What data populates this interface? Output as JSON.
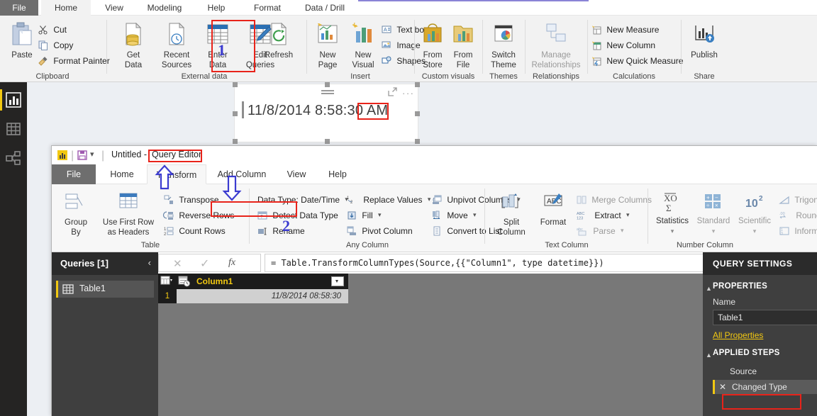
{
  "main_window": {
    "tabs": [
      {
        "label": "File",
        "state": "file"
      },
      {
        "label": "Home",
        "state": "active"
      },
      {
        "label": "View",
        "state": "normal"
      },
      {
        "label": "Modeling",
        "state": "normal"
      },
      {
        "label": "Help",
        "state": "normal"
      },
      {
        "label": "Format",
        "state": "contextual"
      },
      {
        "label": "Data / Drill",
        "state": "contextual"
      }
    ],
    "ribbon": {
      "groups": [
        {
          "label": "Clipboard"
        },
        {
          "label": "External data"
        },
        {
          "label": "Insert"
        },
        {
          "label": "Custom visuals"
        },
        {
          "label": "Themes"
        },
        {
          "label": "Relationships"
        },
        {
          "label": "Calculations"
        },
        {
          "label": "Share"
        }
      ],
      "clipboard": {
        "paste": "Paste",
        "cut": "Cut",
        "copy": "Copy",
        "format_painter": "Format Painter"
      },
      "external_data": {
        "get_data": "Get\nData",
        "get_data_l1": "Get",
        "get_data_l2": "Data",
        "recent_sources_l1": "Recent",
        "recent_sources_l2": "Sources",
        "enter_data_l1": "Enter",
        "enter_data_l2": "Data",
        "edit_queries_l1": "Edit",
        "edit_queries_l2": "Queries",
        "refresh": "Refresh"
      },
      "insert": {
        "new_page_l1": "New",
        "new_page_l2": "Page",
        "new_visual_l1": "New",
        "new_visual_l2": "Visual",
        "text_box": "Text box",
        "image": "Image",
        "shapes": "Shapes"
      },
      "custom_visuals": {
        "from_store_l1": "From",
        "from_store_l2": "Store",
        "from_file_l1": "From",
        "from_file_l2": "File"
      },
      "themes": {
        "switch_theme_l1": "Switch",
        "switch_theme_l2": "Theme"
      },
      "relationships": {
        "manage_l1": "Manage",
        "manage_l2": "Relationships"
      },
      "calculations": {
        "new_measure": "New Measure",
        "new_column": "New Column",
        "new_quick_measure": "New Quick Measure"
      },
      "share": {
        "publish": "Publish"
      }
    },
    "left_nav": [
      {
        "name": "report-view",
        "selected": true
      },
      {
        "name": "data-view",
        "selected": false
      },
      {
        "name": "model-view",
        "selected": false
      }
    ],
    "card_visual": {
      "value": "11/8/2014 8:58:30 AM",
      "highlight_part": "AM"
    }
  },
  "query_editor": {
    "title": "Untitled - Query Editor",
    "title_prefix": "Untitled -",
    "title_highlight": "Query Editor",
    "tabs": [
      {
        "label": "File",
        "state": "file"
      },
      {
        "label": "Home",
        "state": "normal"
      },
      {
        "label": "Transform",
        "state": "active"
      },
      {
        "label": "Add Column",
        "state": "normal"
      },
      {
        "label": "View",
        "state": "normal"
      },
      {
        "label": "Help",
        "state": "normal"
      }
    ],
    "ribbon": {
      "groups": [
        {
          "label": "Table"
        },
        {
          "label": "Any Column"
        },
        {
          "label": "Text Column"
        },
        {
          "label": "Number Column"
        }
      ],
      "table": {
        "group_by_l1": "Group",
        "group_by_l2": "By",
        "use_first_row_l1": "Use First Row",
        "use_first_row_l2": "as Headers",
        "transpose": "Transpose",
        "reverse_rows": "Reverse Rows",
        "count_rows": "Count Rows"
      },
      "any_column": {
        "data_type": "Data Type: Date/Time",
        "detect_data_type": "Detect Data Type",
        "rename": "Rename",
        "replace_values": "Replace Values",
        "fill": "Fill",
        "pivot_column": "Pivot Column",
        "unpivot_columns": "Unpivot Columns",
        "move": "Move",
        "convert_to_list": "Convert to List"
      },
      "text_column": {
        "split_column_l1": "Split",
        "split_column_l2": "Column",
        "format_l1": "Format",
        "merge_columns": "Merge Columns",
        "extract": "Extract",
        "parse": "Parse"
      },
      "number_column": {
        "statistics": "Statistics",
        "standard": "Standard",
        "scientific": "Scientific",
        "trigonometry": "Trigonometry",
        "rounding": "Rounding",
        "information": "Information"
      }
    },
    "formula_bar": {
      "formula": "= Table.TransformColumnTypes(Source,{{\"Column1\", type datetime}})",
      "fx_label": "fx"
    },
    "queries_pane": {
      "title": "Queries [1]",
      "items": [
        {
          "label": "Table1"
        }
      ]
    },
    "data_grid": {
      "column_header": "Column1",
      "rows": [
        {
          "num": "1",
          "value": "11/8/2014 08:58:30"
        }
      ]
    },
    "query_settings": {
      "title": "QUERY SETTINGS",
      "properties_header": "PROPERTIES",
      "name_label": "Name",
      "name_value": "Table1",
      "all_properties_link": "All Properties",
      "applied_steps_header": "APPLIED STEPS",
      "steps": [
        {
          "label": "Source",
          "selected": false
        },
        {
          "label": "Changed Type",
          "selected": true
        }
      ]
    }
  },
  "annotations": {
    "step_one": "1",
    "step_two": "2",
    "accent_red": "#e8231a",
    "accent_blue": "#3b3bd0",
    "accent_yellow": "#f2c811"
  }
}
